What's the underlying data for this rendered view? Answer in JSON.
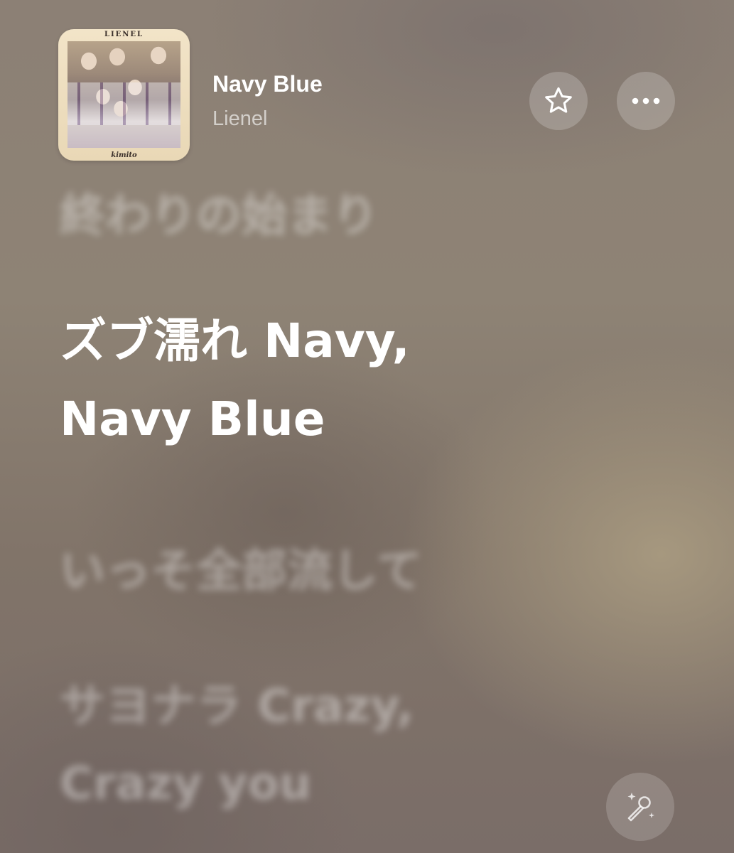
{
  "now_playing": {
    "title": "Navy Blue",
    "artist": "Lienel",
    "artwork": {
      "brand_text": "LIENEL",
      "subtitle_text": "kimito"
    }
  },
  "controls": {
    "favorite_icon": "star-outline-icon",
    "more_icon": "ellipsis-icon",
    "sing_icon": "microphone-sparkles-icon"
  },
  "lyrics": {
    "previous": "終わりの始まり",
    "current_line1": "ズブ濡れ Navy,",
    "current_line2": "Navy Blue",
    "next1": "いっそ全部流して",
    "next2": "サヨナラ Crazy,",
    "next3": "Crazy you"
  },
  "colors": {
    "background": "#8c8075",
    "active_text": "#ffffff",
    "button_fill": "rgba(255,255,255,0.2)"
  }
}
